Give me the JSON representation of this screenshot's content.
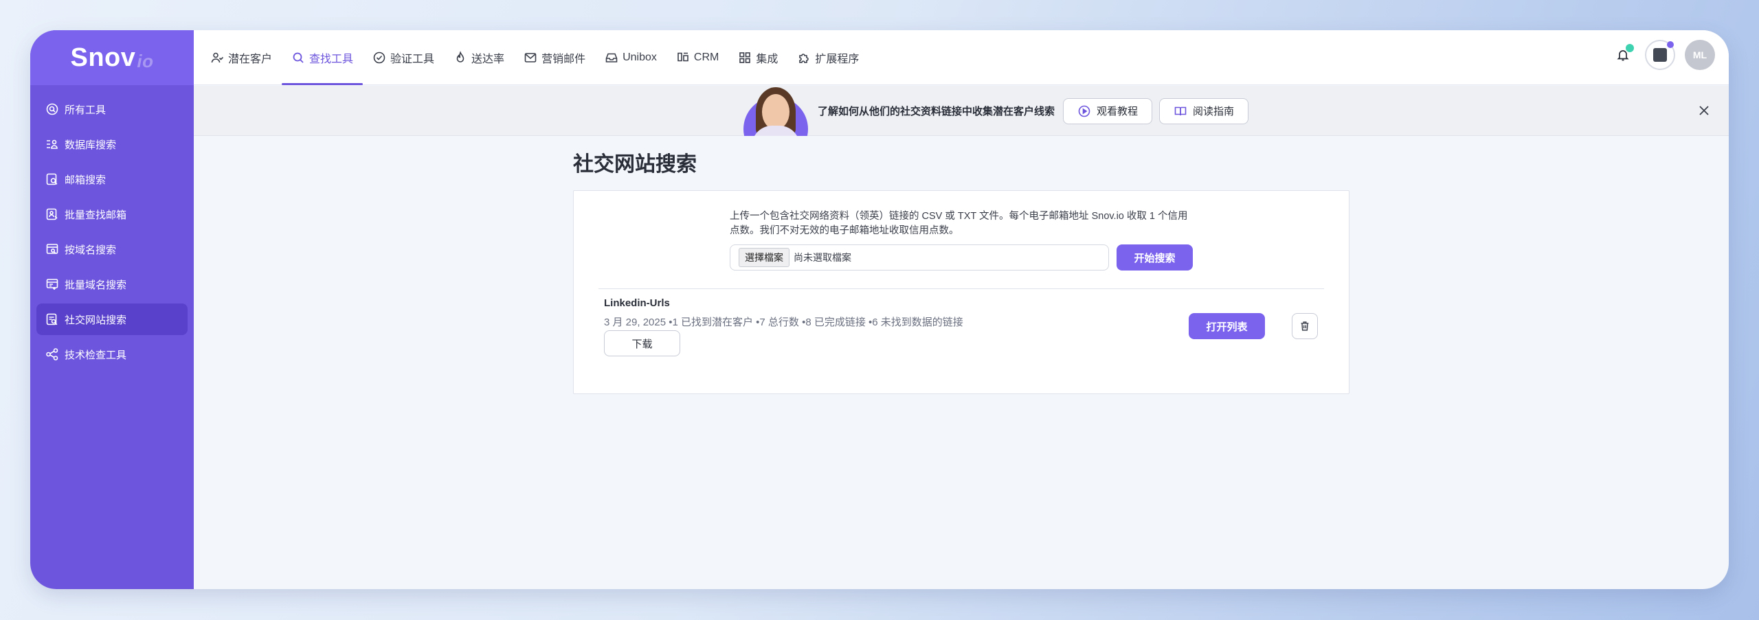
{
  "logo": {
    "brand": "Snov",
    "suffix": "io"
  },
  "sidebar": {
    "items": [
      {
        "label": "所有工具",
        "icon": "search-circle-icon"
      },
      {
        "label": "数据库搜索",
        "icon": "list-user-icon"
      },
      {
        "label": "邮箱搜索",
        "icon": "email-search-icon"
      },
      {
        "label": "批量查找邮箱",
        "icon": "bulk-email-icon"
      },
      {
        "label": "按域名搜索",
        "icon": "domain-search-icon"
      },
      {
        "label": "批量域名搜索",
        "icon": "bulk-domain-icon"
      },
      {
        "label": "社交网站搜索",
        "icon": "social-search-icon",
        "active": true
      },
      {
        "label": "技术检查工具",
        "icon": "tech-check-icon"
      }
    ]
  },
  "nav": {
    "items": [
      {
        "label": "潜在客户",
        "icon": "users-icon"
      },
      {
        "label": "查找工具",
        "icon": "search-icon",
        "active": true
      },
      {
        "label": "验证工具",
        "icon": "check-circle-icon"
      },
      {
        "label": "送达率",
        "icon": "flame-icon"
      },
      {
        "label": "营销邮件",
        "icon": "mail-icon"
      },
      {
        "label": "Unibox",
        "icon": "inbox-icon"
      },
      {
        "label": "CRM",
        "icon": "crm-icon"
      },
      {
        "label": "集成",
        "icon": "grid-icon"
      },
      {
        "label": "扩展程序",
        "icon": "puzzle-icon"
      }
    ]
  },
  "user": {
    "initials": "ML"
  },
  "banner": {
    "text": "了解如何从他们的社交资料链接中收集潜在客户线索",
    "watch_label": "观看教程",
    "read_label": "阅读指南"
  },
  "page": {
    "title": "社交网站搜索"
  },
  "upload": {
    "description": "上传一个包含社交网络资料（领英）链接的 CSV 或 TXT 文件。每个电子邮箱地址 Snov.io 收取 1 个信用点数。我们不对无效的电子邮箱地址收取信用点数。",
    "choose_label": "選擇檔案",
    "no_file_label": "尚未選取檔案",
    "search_label": "开始搜索"
  },
  "result": {
    "name": "Linkedin-Urls",
    "meta": "3 月 29, 2025 •1 已找到潜在客户 •7 总行数 •8 已完成链接 •6 未找到数据的链接",
    "download_label": "下载",
    "open_label": "打开列表"
  },
  "colors": {
    "accent": "#7b63ee",
    "sidebar": "#6d55dd",
    "active_item": "#5a41cc",
    "notification_dot": "#3fd2b0"
  }
}
